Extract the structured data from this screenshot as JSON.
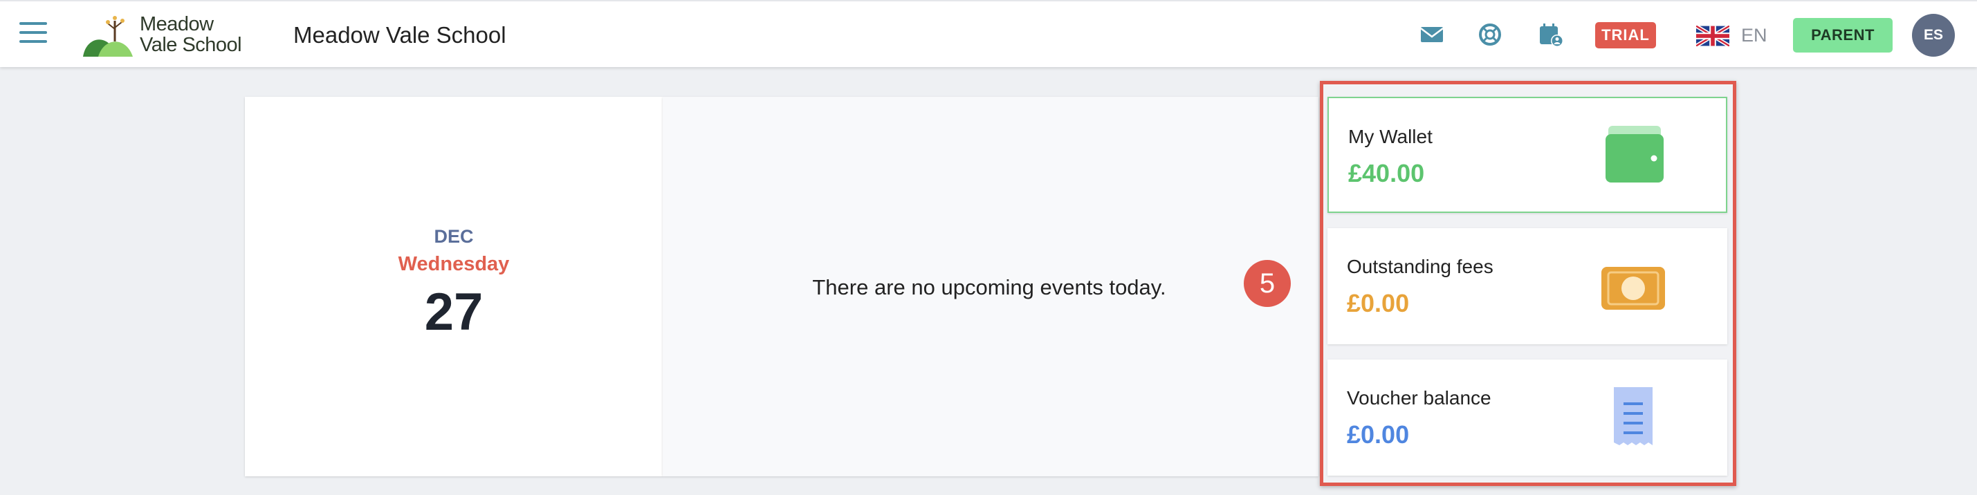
{
  "header": {
    "logo_text_line1": "Meadow",
    "logo_text_line2": "Vale School",
    "school_name": "Meadow Vale School",
    "trial_badge": "TRIAL",
    "language": "EN",
    "role_button": "PARENT",
    "avatar_initials": "ES",
    "icons": [
      "menu-icon",
      "mail-icon",
      "support-icon",
      "calendar-user-icon",
      "uk-flag-icon"
    ]
  },
  "date_panel": {
    "month": "DEC",
    "weekday": "Wednesday",
    "day": "27"
  },
  "events_panel": {
    "message": "There are no upcoming events today."
  },
  "step_badge": "5",
  "finance_cards": [
    {
      "label": "My Wallet",
      "value": "£40.00",
      "color": "#5cc46e",
      "icon": "wallet-icon"
    },
    {
      "label": "Outstanding fees",
      "value": "£0.00",
      "color": "#e8a33a",
      "icon": "banknote-icon"
    },
    {
      "label": "Voucher balance",
      "value": "£0.00",
      "color": "#4f86e0",
      "icon": "receipt-icon"
    }
  ],
  "colors": {
    "accent_red": "#e05a4f",
    "parent_green": "#7fe39a",
    "header_icon": "#4a8fa8"
  }
}
